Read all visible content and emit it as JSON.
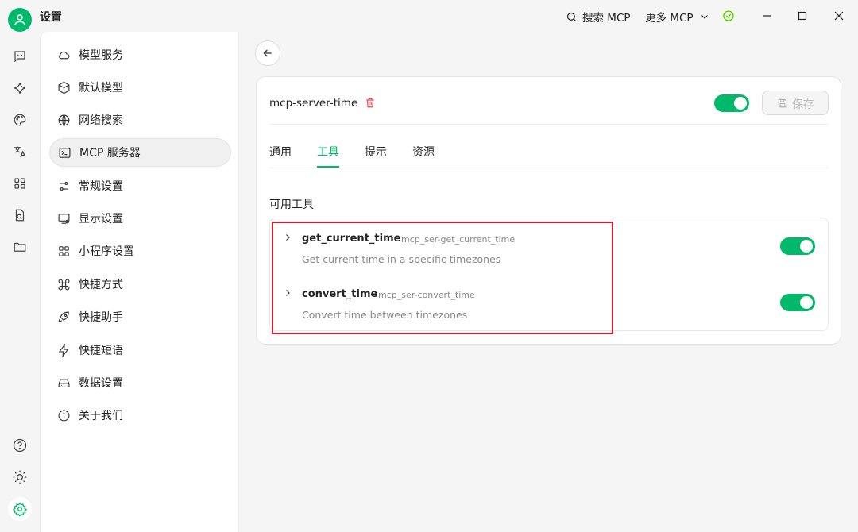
{
  "app": {
    "title": "设置"
  },
  "titlebar": {
    "search_mcp_label": "搜索 MCP",
    "more_mcp_label": "更多 MCP"
  },
  "sidebar": {
    "items": [
      {
        "label": "模型服务",
        "icon": "cloud-icon",
        "active": false
      },
      {
        "label": "默认模型",
        "icon": "cube-icon",
        "active": false
      },
      {
        "label": "网络搜索",
        "icon": "globe-icon",
        "active": false
      },
      {
        "label": "MCP 服务器",
        "icon": "terminal-icon",
        "active": true
      },
      {
        "label": "常规设置",
        "icon": "sliders-icon",
        "active": false
      },
      {
        "label": "显示设置",
        "icon": "monitor-icon",
        "active": false
      },
      {
        "label": "小程序设置",
        "icon": "grid-icon",
        "active": false
      },
      {
        "label": "快捷方式",
        "icon": "command-icon",
        "active": false
      },
      {
        "label": "快捷助手",
        "icon": "rocket-icon",
        "active": false
      },
      {
        "label": "快捷短语",
        "icon": "zap-icon",
        "active": false
      },
      {
        "label": "数据设置",
        "icon": "hard-drive-icon",
        "active": false
      },
      {
        "label": "关于我们",
        "icon": "info-icon",
        "active": false
      }
    ]
  },
  "server": {
    "name": "mcp-server-time",
    "enabled": true,
    "save_label": "保存"
  },
  "tabs": [
    {
      "label": "通用",
      "active": false
    },
    {
      "label": "工具",
      "active": true
    },
    {
      "label": "提示",
      "active": false
    },
    {
      "label": "资源",
      "active": false
    }
  ],
  "tools_section": {
    "title": "可用工具",
    "tools": [
      {
        "name": "get_current_time",
        "id": "mcp_ser-get_current_time",
        "description": "Get current time in a specific timezones",
        "enabled": true
      },
      {
        "name": "convert_time",
        "id": "mcp_ser-convert_time",
        "description": "Convert time between timezones",
        "enabled": true
      }
    ]
  },
  "colors": {
    "accent": "#00b96b",
    "danger": "#e5484d",
    "highlight": "#d01f2a"
  }
}
